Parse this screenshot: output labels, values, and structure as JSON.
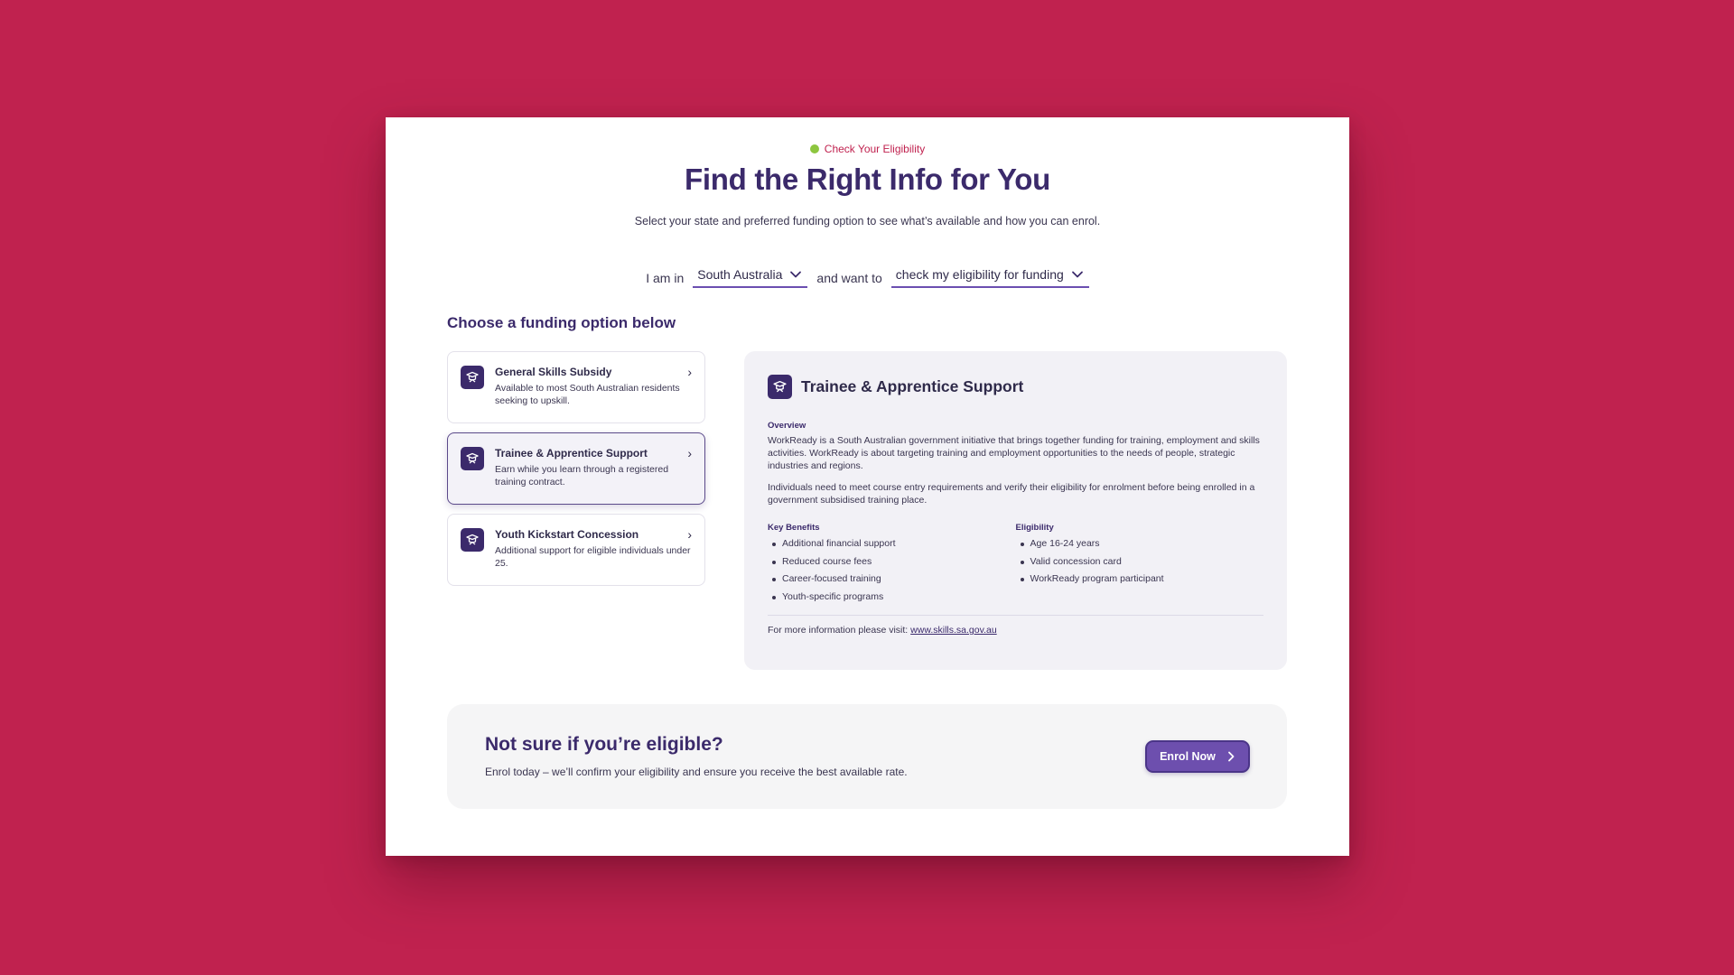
{
  "eyebrow": "Check Your Eligibility",
  "title": "Find the Right Info for You",
  "subtitle": "Select your state and preferred funding option to see what’s available and how you can enrol.",
  "selector": {
    "prefix": "I am in",
    "state_value": "South Australia",
    "middle": "and want to",
    "goal_value": "check my eligibility for funding"
  },
  "section_head": "Choose a funding option below",
  "options": [
    {
      "title": "General Skills Subsidy",
      "desc": "Available to most South Australian residents seeking to upskill."
    },
    {
      "title": "Trainee & Apprentice Support",
      "desc": "Earn while you learn through a registered training contract."
    },
    {
      "title": "Youth Kickstart Concession",
      "desc": "Additional support for eligible individuals under 25."
    }
  ],
  "detail": {
    "title": "Trainee & Apprentice Support",
    "overview_label": "Overview",
    "overview_p1": "WorkReady is a South Australian government initiative that brings together funding for training, employment and skills activities. WorkReady is about targeting training and employment opportunities to the needs of people, strategic industries and regions.",
    "overview_p2": "Individuals need to meet course entry requirements and verify their eligibility for enrolment before being enrolled in a government subsidised training place.",
    "benefits_label": "Key Benefits",
    "benefits": [
      "Additional financial support",
      "Reduced course fees",
      "Career-focused training",
      "Youth-specific programs"
    ],
    "eligibility_label": "Eligibility",
    "eligibility": [
      "Age 16-24 years",
      "Valid concession card",
      "WorkReady program participant"
    ],
    "footer_text": "For more information please visit:",
    "footer_link": "www.skills.sa.gov.au"
  },
  "cta": {
    "title": "Not sure if you’re eligible?",
    "subtitle": "Enrol today – we’ll confirm your eligibility and ensure you receive the best available rate.",
    "button_label": "Enrol Now"
  },
  "colors": {
    "background": "#c0224f",
    "primary": "#3b2a6b",
    "button": "#6d4fae",
    "status_dot": "#8dc63f"
  }
}
